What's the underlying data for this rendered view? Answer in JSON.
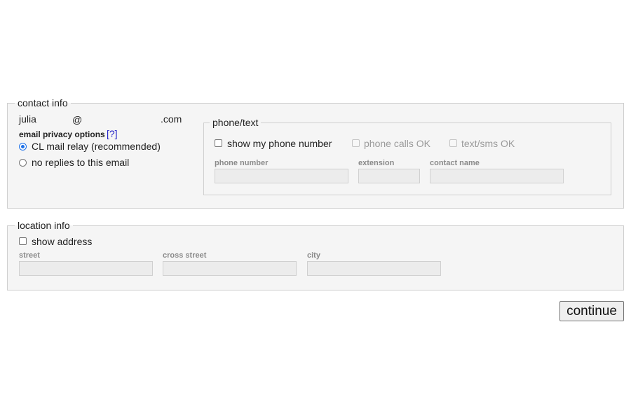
{
  "contact": {
    "legend": "contact info",
    "email_user": "julia",
    "email_at": "@",
    "email_domain": ".com",
    "privacy_label": "email privacy options",
    "help_link": "[?]",
    "radio_relay": "CL mail relay (recommended)",
    "radio_relay_selected": true,
    "radio_noreply": "no replies to this email",
    "radio_noreply_selected": false
  },
  "phone": {
    "legend": "phone/text",
    "show_phone": "show my phone number",
    "show_phone_checked": false,
    "calls_ok": "phone calls OK",
    "sms_ok": "text/sms OK",
    "phone_number_label": "phone number",
    "phone_number_value": "",
    "extension_label": "extension",
    "extension_value": "",
    "contact_name_label": "contact name",
    "contact_name_value": ""
  },
  "location": {
    "legend": "location info",
    "show_address": "show address",
    "show_address_checked": false,
    "street_label": "street",
    "street_value": "",
    "cross_street_label": "cross street",
    "cross_street_value": "",
    "city_label": "city",
    "city_value": ""
  },
  "actions": {
    "continue_label": "continue"
  },
  "colors": {
    "accent": "#1a6fe8",
    "link": "#2020c8",
    "panel_bg": "#f5f5f5"
  }
}
